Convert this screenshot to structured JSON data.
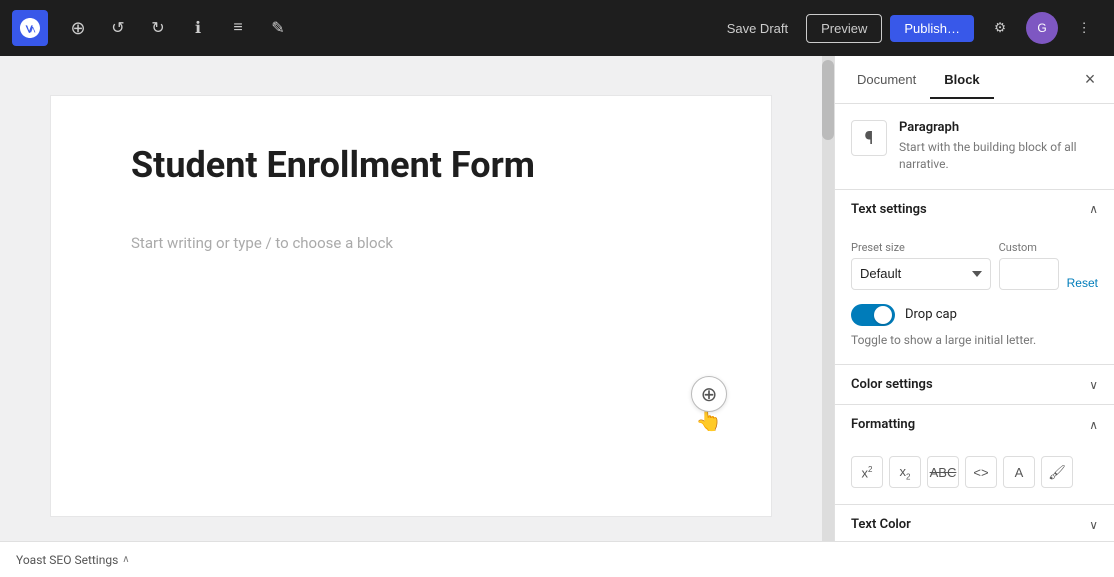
{
  "toolbar": {
    "add_label": "+",
    "undo_label": "↺",
    "redo_label": "↻",
    "info_label": "ℹ",
    "list_label": "≡",
    "edit_label": "✎",
    "save_draft_label": "Save Draft",
    "preview_label": "Preview",
    "publish_label": "Publish…",
    "settings_label": "⚙",
    "avatar_label": "G",
    "more_label": "⋮"
  },
  "editor": {
    "post_title": "Student Enrollment Form",
    "block_placeholder": "Start writing or type / to choose a block"
  },
  "sidebar": {
    "tab_document": "Document",
    "tab_block": "Block",
    "close_label": "×",
    "block_icon": "¶",
    "block_title": "Paragraph",
    "block_desc": "Start with the building block of all narrative.",
    "text_settings_title": "Text settings",
    "preset_size_label": "Preset size",
    "custom_label": "Custom",
    "reset_label": "Reset",
    "preset_default": "Default",
    "drop_cap_label": "Drop cap",
    "drop_cap_desc": "Toggle to show a large initial letter.",
    "color_settings_title": "Color settings",
    "formatting_title": "Formatting",
    "text_color_title": "Text Color",
    "superscript_label": "x²",
    "subscript_label": "x₂",
    "strikethrough_label": "ABC",
    "code_label": "<>",
    "keyboard_label": "A",
    "highlight_label": "🖌"
  },
  "bottom_bar": {
    "label": "Yoast SEO Settings",
    "chevron": "∧"
  }
}
